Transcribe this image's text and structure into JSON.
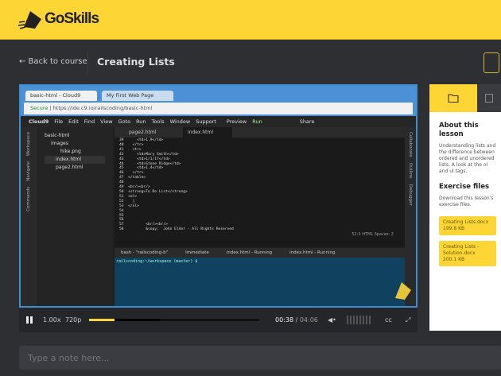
{
  "header": {
    "brand": "GoSkills"
  },
  "nav": {
    "back": "← Back to course",
    "title": "Creating Lists"
  },
  "video": {
    "browser_tabs": [
      "basic-html - Cloud9",
      "My First Web Page"
    ],
    "secure": "Secure",
    "url": "https://ide.c9.io/railscoding/basic-html",
    "menu": [
      "Cloud9",
      "File",
      "Edit",
      "Find",
      "View",
      "Goto",
      "Run",
      "Tools",
      "Window",
      "Support",
      "Preview",
      "Run",
      "Share"
    ],
    "side_tabs": [
      "Workspace",
      "Navigate",
      "Commands"
    ],
    "right_tabs": [
      "Collaborate",
      "Outline",
      "Debugger"
    ],
    "tree": [
      "basic-html",
      "images",
      "hike.png",
      "index.html",
      "page2.html"
    ],
    "editor_tabs": [
      "page2.html",
      "index.html"
    ],
    "code": "39      <td>1.9</td>\n40    </tr>\n41    <tr>\n42      <td>Mary Smith</td>\n43      <td>1/1/17</td>\n44      <td>Stone Ridge</td>\n45      <td>1.4</td>\n46    </tr>\n47  </table>\n48\n49  <br/><br/>\n50  <strong>To Do List</strong>\n51  <ol>\n52    |\n53  </ol>\n54\n55\n56\n57          <br/><br/>\n58          &copy;  John Elder - All Rights Reserved",
    "status": "52:3   HTML   Spaces: 2",
    "terminal_tabs": [
      "bash - \"railscoding-b\"",
      "Immediate",
      "index.html - Running",
      "index.html - Running"
    ],
    "prompt": "railscoding:~/workspace (master) $"
  },
  "player": {
    "speed": "1.00x",
    "quality": "720p",
    "current": "00:38",
    "duration": "04:06",
    "progress_percent": 15,
    "buffered_percent": 42,
    "cc": "cc"
  },
  "note": {
    "placeholder": "Type a note here..."
  },
  "panel": {
    "about_title": "About this lesson",
    "about_text": [
      "Understanding lists and the difference",
      "between ordered and unordered lists. A",
      "look at the ol and ul tags."
    ],
    "files_title": "Exercise files",
    "files_text": "Download this lesson's exercise files.",
    "files": [
      {
        "name": "Creating Lists.docx",
        "size": "199.8 KB"
      },
      {
        "name": "Creating Lists - Solution.docx",
        "size": "200.1 KB"
      }
    ]
  },
  "colors": {
    "brand_yellow": "#fdd534",
    "dark_bg": "#2e2f33"
  }
}
